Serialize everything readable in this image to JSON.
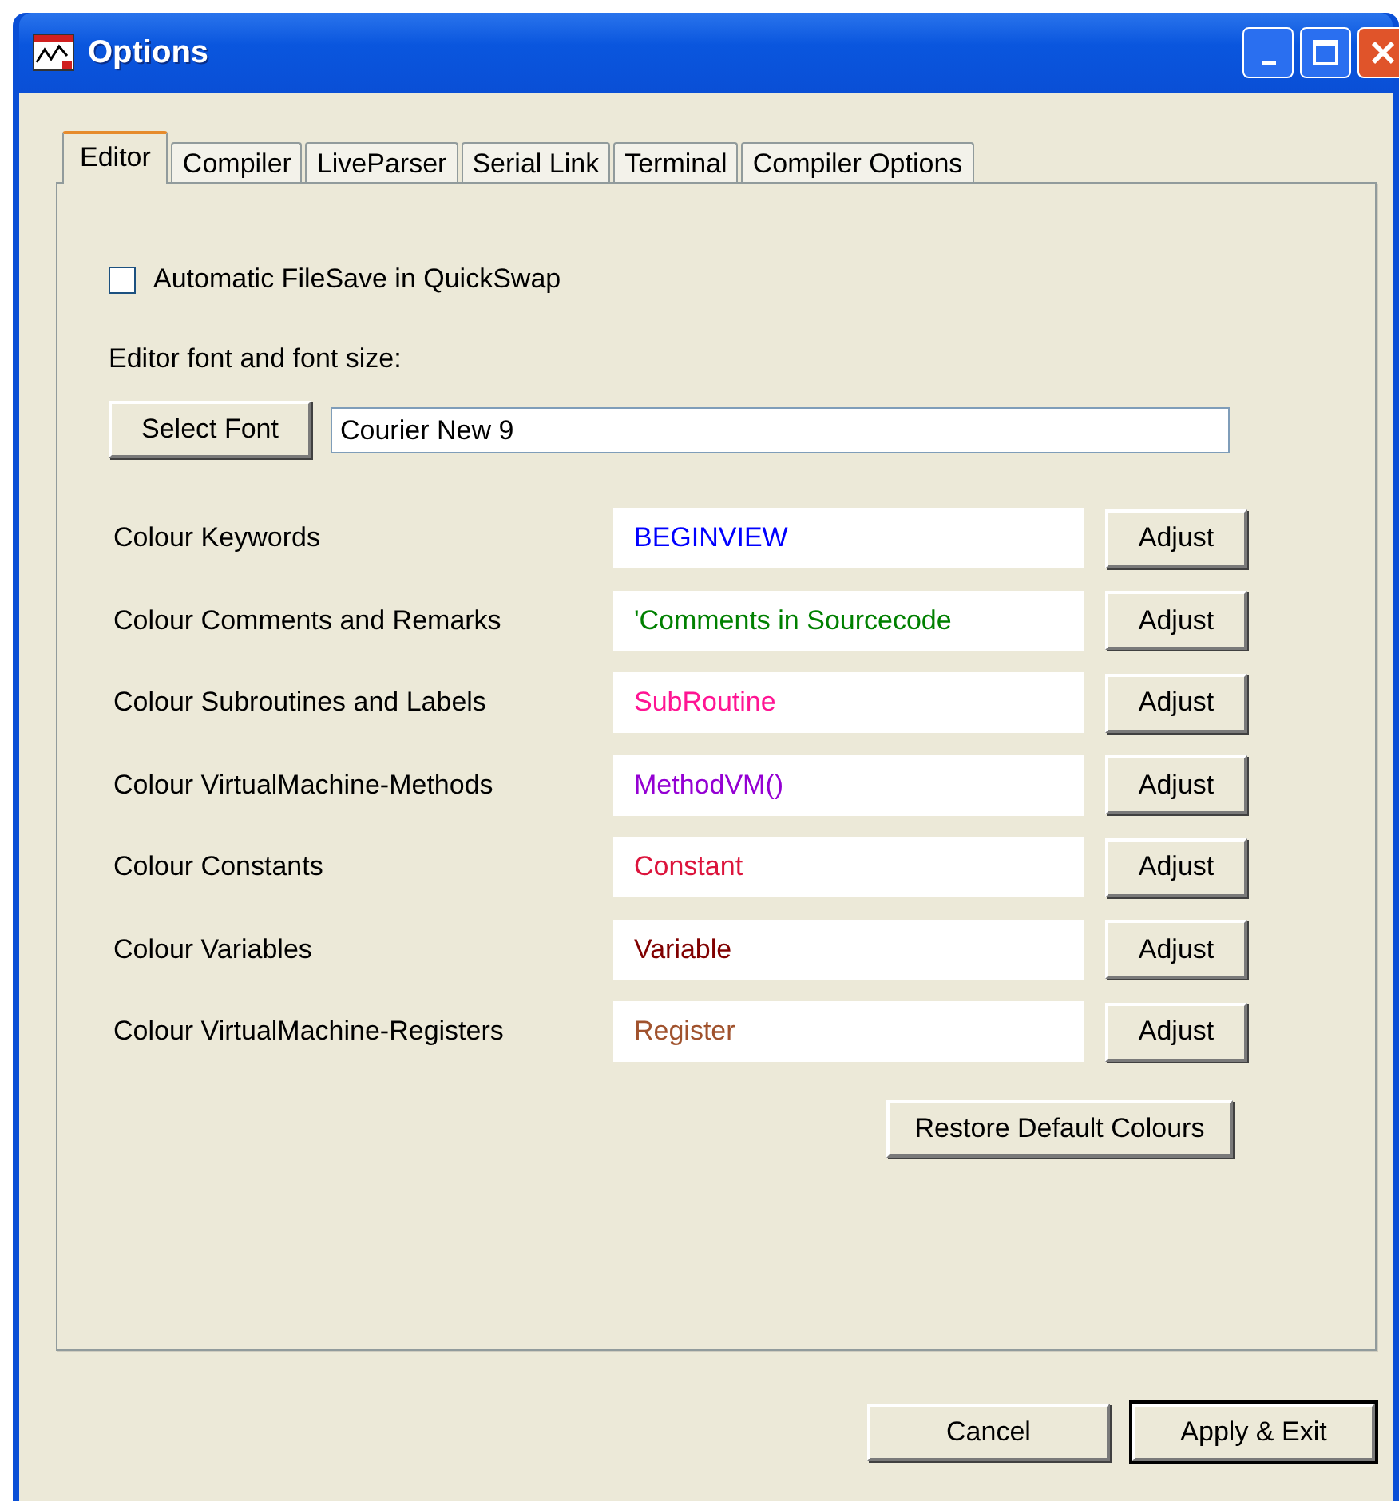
{
  "window": {
    "title": "Options"
  },
  "tabs": [
    {
      "label": "Editor",
      "selected": true
    },
    {
      "label": "Compiler",
      "selected": false
    },
    {
      "label": "LiveParser",
      "selected": false
    },
    {
      "label": "Serial Link",
      "selected": false
    },
    {
      "label": "Terminal",
      "selected": false
    },
    {
      "label": "Compiler Options",
      "selected": false
    }
  ],
  "autosave": {
    "label": "Automatic FileSave in QuickSwap",
    "checked": false
  },
  "font": {
    "label": "Editor font and font size:",
    "button": "Select Font",
    "value": "Courier New 9"
  },
  "colours": [
    {
      "label": "Colour Keywords",
      "sample": "BEGINVIEW",
      "color": "#0000ff",
      "button": "Adjust"
    },
    {
      "label": "Colour Comments and Remarks",
      "sample": "'Comments in Sourcecode",
      "color": "#008000",
      "button": "Adjust"
    },
    {
      "label": "Colour Subroutines and Labels",
      "sample": "SubRoutine",
      "color": "#ff1493",
      "button": "Adjust"
    },
    {
      "label": "Colour VirtualMachine-Methods",
      "sample": "MethodVM()",
      "color": "#9400d3",
      "button": "Adjust"
    },
    {
      "label": "Colour Constants",
      "sample": "Constant",
      "color": "#dc143c",
      "button": "Adjust"
    },
    {
      "label": "Colour Variables",
      "sample": "Variable",
      "color": "#800000",
      "button": "Adjust"
    },
    {
      "label": "Colour VirtualMachine-Registers",
      "sample": "Register",
      "color": "#a0522d",
      "button": "Adjust"
    }
  ],
  "restore_button": "Restore Default Colours",
  "buttons": [
    {
      "label": "Cancel",
      "default": false
    },
    {
      "label": "Apply & Exit",
      "default": true
    }
  ]
}
